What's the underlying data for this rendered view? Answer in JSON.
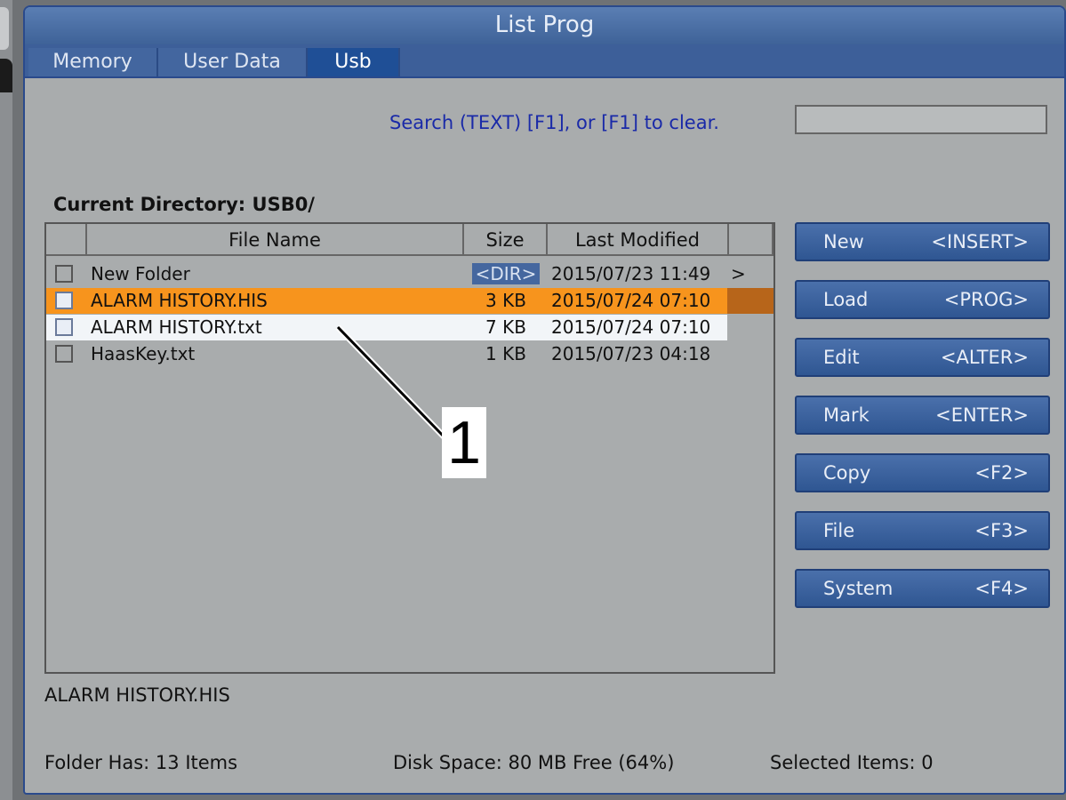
{
  "window": {
    "title": "List Prog"
  },
  "tabs": [
    {
      "label": "Memory"
    },
    {
      "label": "User Data"
    },
    {
      "label": "Usb"
    }
  ],
  "search": {
    "hint": "Search (TEXT) [F1], or [F1] to clear.",
    "value": ""
  },
  "current_directory": "Current Directory: USB0/",
  "columns": {
    "name": "File Name",
    "size": "Size",
    "modified": "Last Modified"
  },
  "files": [
    {
      "name": "New Folder",
      "size": "<DIR>",
      "modified": "2015/07/23 11:49",
      "arrow": ">"
    },
    {
      "name": "ALARM HISTORY.HIS",
      "size": "3 KB",
      "modified": "2015/07/24 07:10"
    },
    {
      "name": "ALARM HISTORY.txt",
      "size": "7 KB",
      "modified": "2015/07/24 07:10"
    },
    {
      "name": "HaasKey.txt",
      "size": "1 KB",
      "modified": "2015/07/23 04:18"
    }
  ],
  "buttons": [
    {
      "label": "New",
      "key": "<INSERT>"
    },
    {
      "label": "Load",
      "key": "<PROG>"
    },
    {
      "label": "Edit",
      "key": "<ALTER>"
    },
    {
      "label": "Mark",
      "key": "<ENTER>"
    },
    {
      "label": "Copy",
      "key": "<F2>"
    },
    {
      "label": "File",
      "key": "<F3>"
    },
    {
      "label": "System",
      "key": "<F4>"
    }
  ],
  "selected_file_name": "ALARM HISTORY.HIS",
  "status": {
    "folder": "Folder Has: 13 Items",
    "disk": "Disk Space: 80 MB Free (64%)",
    "selected": "Selected Items: 0"
  },
  "callout": {
    "number": "1"
  },
  "colors": {
    "selected_row": "#f7941d",
    "tab_active": "#1f4f96",
    "button": "#3a5f9a"
  }
}
